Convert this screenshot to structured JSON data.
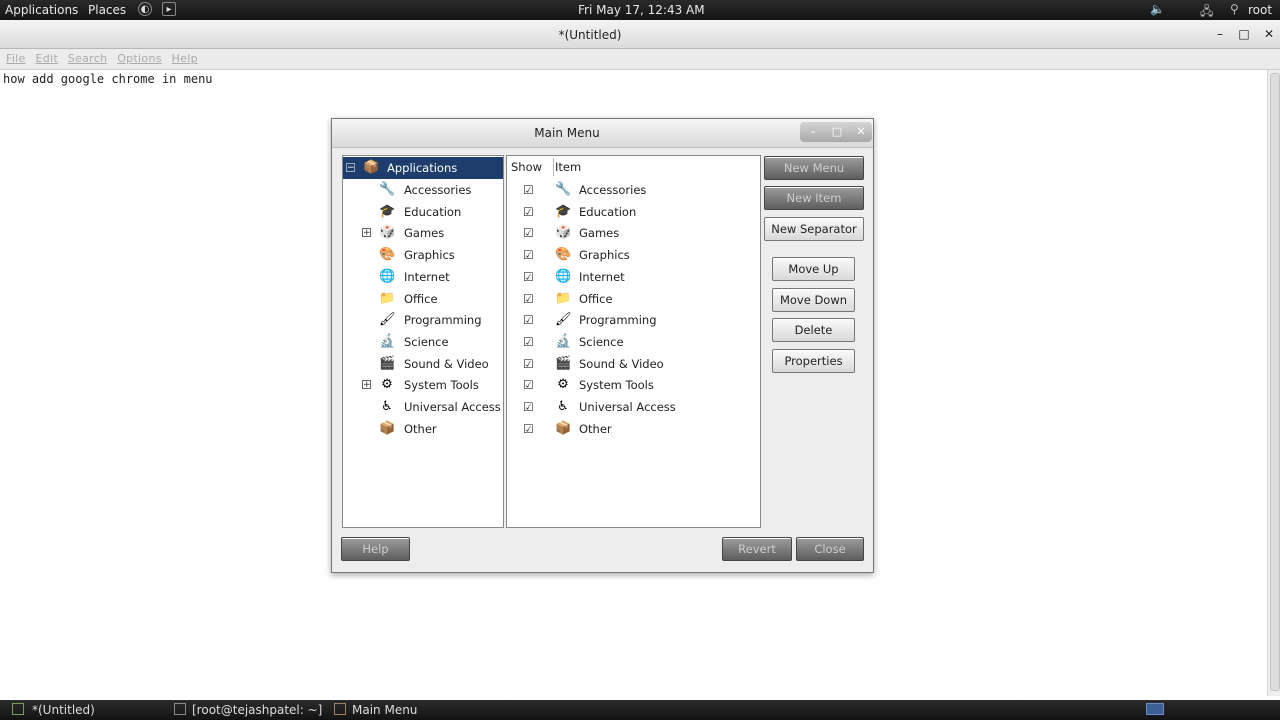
{
  "topbar": {
    "applications": "Applications",
    "places": "Places",
    "clock": "Fri May 17, 12:43 AM",
    "user": "root"
  },
  "editor_window": {
    "title": "*(Untitled)",
    "menu": [
      "File",
      "Edit",
      "Search",
      "Options",
      "Help"
    ],
    "text": "how add google chrome in menu"
  },
  "dialog": {
    "title": "Main Menu",
    "tree": {
      "root": "Applications",
      "items": [
        {
          "label": "Accessories",
          "icon": "accessories-icon",
          "glyph": "🔧",
          "expandable": false
        },
        {
          "label": "Education",
          "icon": "education-icon",
          "glyph": "🎓",
          "expandable": false
        },
        {
          "label": "Games",
          "icon": "games-icon",
          "glyph": "🎲",
          "expandable": true
        },
        {
          "label": "Graphics",
          "icon": "graphics-icon",
          "glyph": "🎨",
          "expandable": false
        },
        {
          "label": "Internet",
          "icon": "internet-icon",
          "glyph": "🌐",
          "expandable": false
        },
        {
          "label": "Office",
          "icon": "office-icon",
          "glyph": "📁",
          "expandable": false
        },
        {
          "label": "Programming",
          "icon": "programming-icon",
          "glyph": "🖌",
          "expandable": false
        },
        {
          "label": "Science",
          "icon": "science-icon",
          "glyph": "🔬",
          "expandable": false
        },
        {
          "label": "Sound & Video",
          "icon": "sound-video-icon",
          "glyph": "🎬",
          "expandable": false
        },
        {
          "label": "System Tools",
          "icon": "system-tools-icon",
          "glyph": "⚙",
          "expandable": true
        },
        {
          "label": "Universal Access",
          "icon": "universal-access-icon",
          "glyph": "♿",
          "expandable": false
        },
        {
          "label": "Other",
          "icon": "other-icon",
          "glyph": "📦",
          "expandable": false
        }
      ]
    },
    "list": {
      "col_show": "Show",
      "col_item": "Item",
      "items": [
        {
          "label": "Accessories",
          "icon": "accessories-icon",
          "glyph": "🔧",
          "checked": true
        },
        {
          "label": "Education",
          "icon": "education-icon",
          "glyph": "🎓",
          "checked": true
        },
        {
          "label": "Games",
          "icon": "games-icon",
          "glyph": "🎲",
          "checked": true
        },
        {
          "label": "Graphics",
          "icon": "graphics-icon",
          "glyph": "🎨",
          "checked": true
        },
        {
          "label": "Internet",
          "icon": "internet-icon",
          "glyph": "🌐",
          "checked": true
        },
        {
          "label": "Office",
          "icon": "office-icon",
          "glyph": "📁",
          "checked": true
        },
        {
          "label": "Programming",
          "icon": "programming-icon",
          "glyph": "🖌",
          "checked": true
        },
        {
          "label": "Science",
          "icon": "science-icon",
          "glyph": "🔬",
          "checked": true
        },
        {
          "label": "Sound & Video",
          "icon": "sound-video-icon",
          "glyph": "🎬",
          "checked": true
        },
        {
          "label": "System Tools",
          "icon": "system-tools-icon",
          "glyph": "⚙",
          "checked": true
        },
        {
          "label": "Universal Access",
          "icon": "universal-access-icon",
          "glyph": "♿",
          "checked": true
        },
        {
          "label": "Other",
          "icon": "other-icon",
          "glyph": "📦",
          "checked": true
        }
      ]
    },
    "buttons": {
      "new_menu": "New Menu",
      "new_item": "New Item",
      "new_separator": "New Separator",
      "move_up": "Move Up",
      "move_down": "Move Down",
      "delete": "Delete",
      "properties": "Properties",
      "help": "Help",
      "revert": "Revert",
      "close": "Close"
    }
  },
  "taskbar": {
    "tasks": [
      "*(Untitled)",
      "[root@tejashpatel: ~]",
      "Main Menu"
    ]
  },
  "colors": {
    "selection": "#1f3d6c",
    "panel": "#141414"
  }
}
